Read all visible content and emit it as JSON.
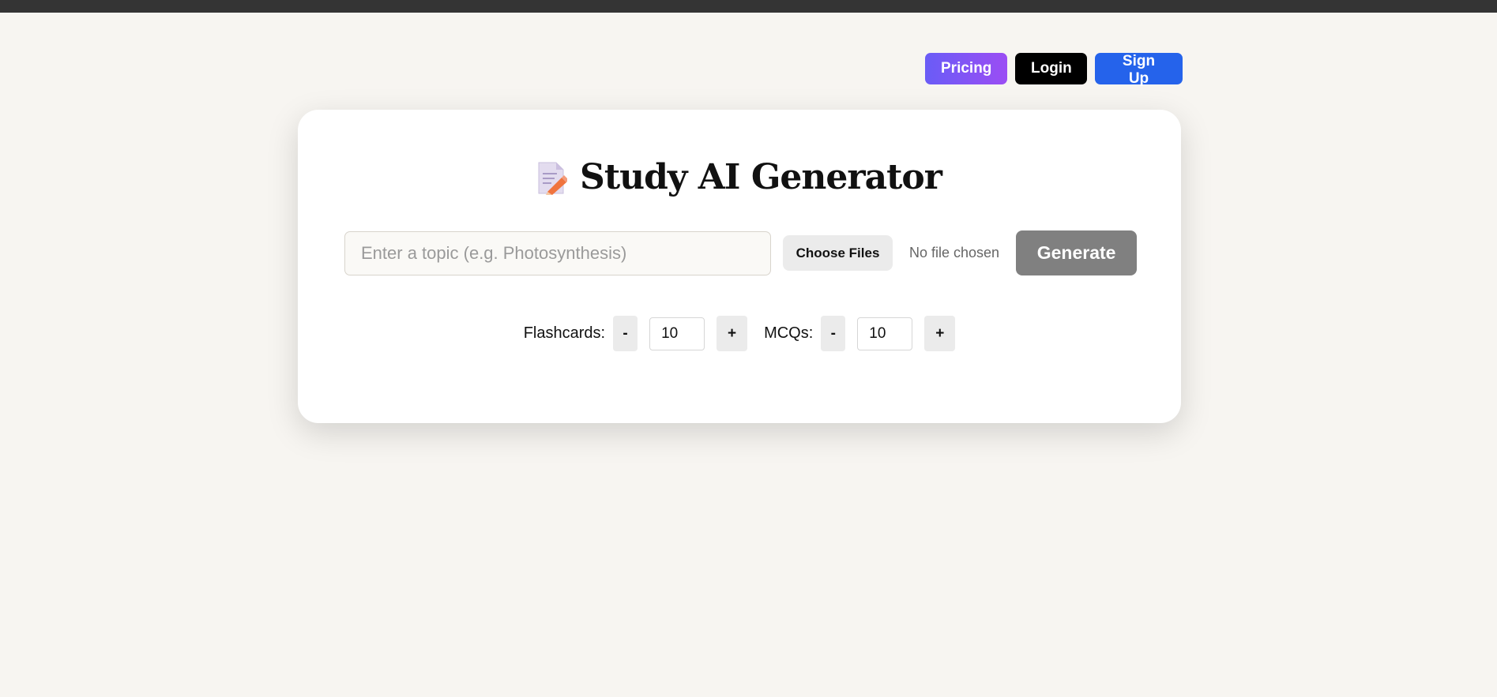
{
  "nav": {
    "pricing_label": "Pricing",
    "login_label": "Login",
    "signup_label": "Sign Up"
  },
  "main": {
    "title": "Study AI Generator",
    "title_icon": "memo-icon",
    "topic_input": {
      "placeholder": "Enter a topic (e.g. Photosynthesis)",
      "value": ""
    },
    "choose_files_label": "Choose Files",
    "file_status": "No file chosen",
    "generate_label": "Generate"
  },
  "counts": {
    "flashcards": {
      "label": "Flashcards:",
      "minus_label": "-",
      "plus_label": "+",
      "value": "10"
    },
    "mcqs": {
      "label": "MCQs:",
      "minus_label": "-",
      "plus_label": "+",
      "value": "10"
    }
  },
  "colors": {
    "background": "#f7f5f1",
    "topbar": "#343434",
    "pricing_gradient_start": "#6a5cf6",
    "pricing_gradient_end": "#9b4df4",
    "login": "#000000",
    "signup": "#2563eb",
    "generate": "#808080"
  }
}
